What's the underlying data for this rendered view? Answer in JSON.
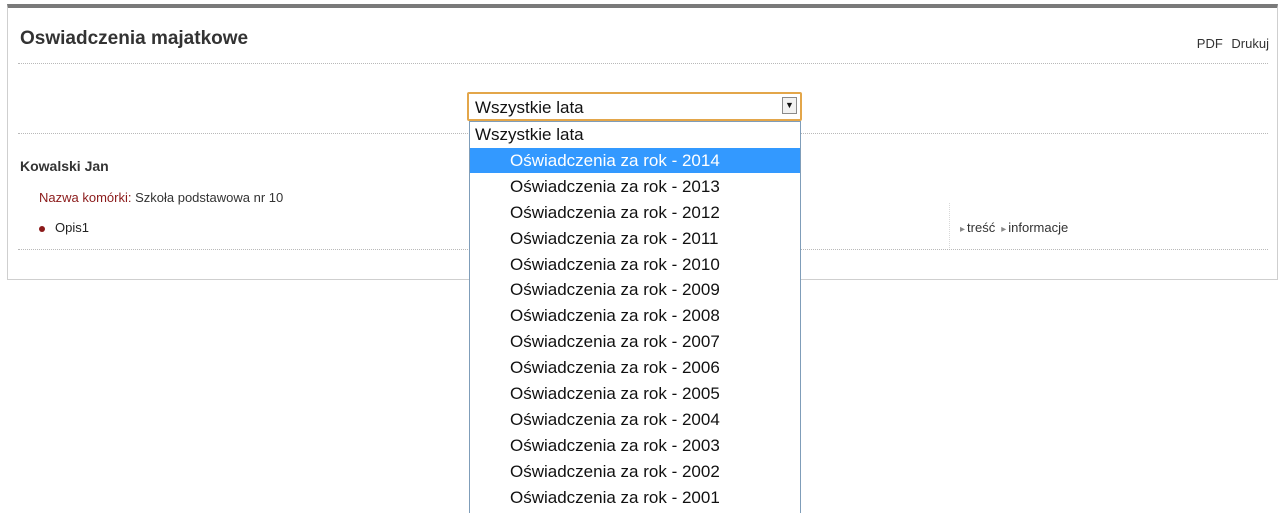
{
  "header": {
    "title": "Oswiadczenia majatkowe",
    "pdf_label": "PDF",
    "print_label": "Drukuj"
  },
  "year_select": {
    "selected_value": "Wszystkie lata",
    "highlighted_index": 1,
    "options": [
      "Wszystkie lata",
      "Oświadczenia za rok - 2014",
      "Oświadczenia za rok - 2013",
      "Oświadczenia za rok - 2012",
      "Oświadczenia za rok - 2011",
      "Oświadczenia za rok - 2010",
      "Oświadczenia za rok - 2009",
      "Oświadczenia za rok - 2008",
      "Oświadczenia za rok - 2007",
      "Oświadczenia za rok - 2006",
      "Oświadczenia za rok - 2005",
      "Oświadczenia za rok - 2004",
      "Oświadczenia za rok - 2003",
      "Oświadczenia za rok - 2002",
      "Oświadczenia za rok - 2001"
    ]
  },
  "person": {
    "name": "Kowalski Jan",
    "unit_label": "Nazwa komórki:",
    "unit_value": "Szkoła podstawowa nr 10",
    "item_label": "Opis1",
    "link_content": "treść",
    "link_info": "informacje"
  },
  "colors": {
    "accent_red": "#8b1a1a",
    "select_focus": "#e3a64a",
    "highlight": "#3399ff"
  }
}
